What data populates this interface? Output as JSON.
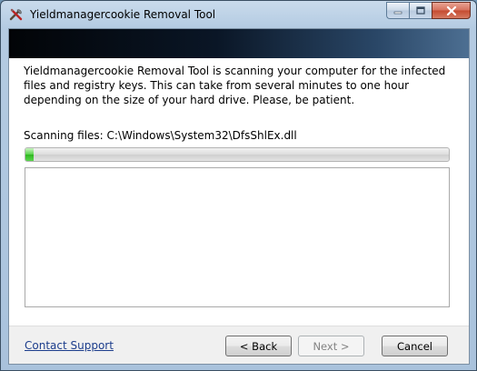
{
  "window": {
    "title": "Yieldmanagercookie Removal Tool",
    "icon": "tools-icon"
  },
  "caption_buttons": {
    "minimize_icon": "minimize-icon",
    "maximize_icon": "maximize-icon",
    "close_icon": "close-icon"
  },
  "main": {
    "description": "Yieldmanagercookie Removal Tool is scanning your computer for the infected files and registry keys. This can take from several minutes to one hour depending on the size of your hard drive. Please, be patient.",
    "scan_label": "Scanning files: C:\\Windows\\System32\\DfsShlEx.dll",
    "progress_percent": 2
  },
  "footer": {
    "contact_support": "Contact Support",
    "back_label": "< Back",
    "next_label": "Next >",
    "cancel_label": "Cancel"
  },
  "colors": {
    "progress_green": "#2fb620",
    "link_blue": "#1c3d8c",
    "close_red": "#c44a2f"
  }
}
